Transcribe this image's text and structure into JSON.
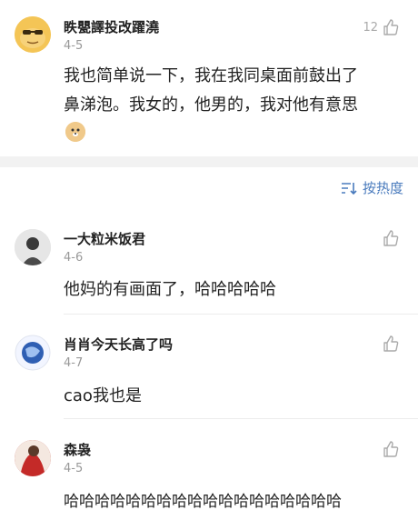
{
  "colors": {
    "accent": "#4a7bbd",
    "muted": "#999999",
    "band": "#f2f2f2"
  },
  "top_comment": {
    "name": "眣甖譯投改躍澆",
    "date": "4-5",
    "likes": "12",
    "text_line1": "我也简单说一下，我在我同桌面前鼓出了",
    "text_line2": "鼻涕泡。我女的，他男的，我对他有意思",
    "emoji": "doge-emoji"
  },
  "sort": {
    "label": "按热度",
    "icon": "sort-icon"
  },
  "comments": [
    {
      "name": "一大粒米饭君",
      "date": "4-6",
      "text": "他妈的有画面了，哈哈哈哈哈"
    },
    {
      "name": "肖肖今天长高了吗",
      "date": "4-7",
      "text": "cao我也是"
    },
    {
      "name": "森袅",
      "date": "4-5",
      "text": "哈哈哈哈哈哈哈哈哈哈哈哈哈哈哈哈哈哈"
    }
  ]
}
